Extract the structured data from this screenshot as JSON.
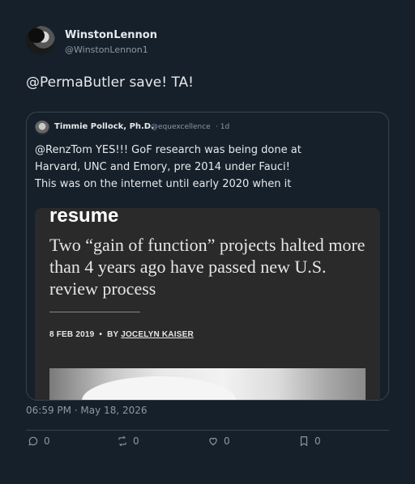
{
  "tweet": {
    "author_name": "WinstonLennon",
    "author_handle": "@WinstonLennon1",
    "text": "@PermaButler save! TA!",
    "timestamp": "06:59 PM · May 18, 2026"
  },
  "quote": {
    "author_name": "Timmie Pollock, Ph.D.",
    "author_handle": "@equexcellence",
    "time_ago": "· 1d",
    "text": "@RenzTom YES!!! GoF research was being done at Harvard, UNC and Emory, pre 2014 under Fauci! This was on the internet until early 2020 when it",
    "image": {
      "overline": "resume",
      "headline": "Two “gain of function” projects halted more than 4 years ago have passed new U.S. review process",
      "date": "8 FEB 2019",
      "separator": "•",
      "by": "BY",
      "author": "JOCELYN KAISER"
    }
  },
  "actions": {
    "reply_count": "0",
    "retweet_count": "0",
    "like_count": "0",
    "bookmark_count": "0"
  },
  "colors": {
    "background": "#15202b",
    "text": "#e7e9ea",
    "secondary": "#8b98a5",
    "border": "#38444d"
  }
}
